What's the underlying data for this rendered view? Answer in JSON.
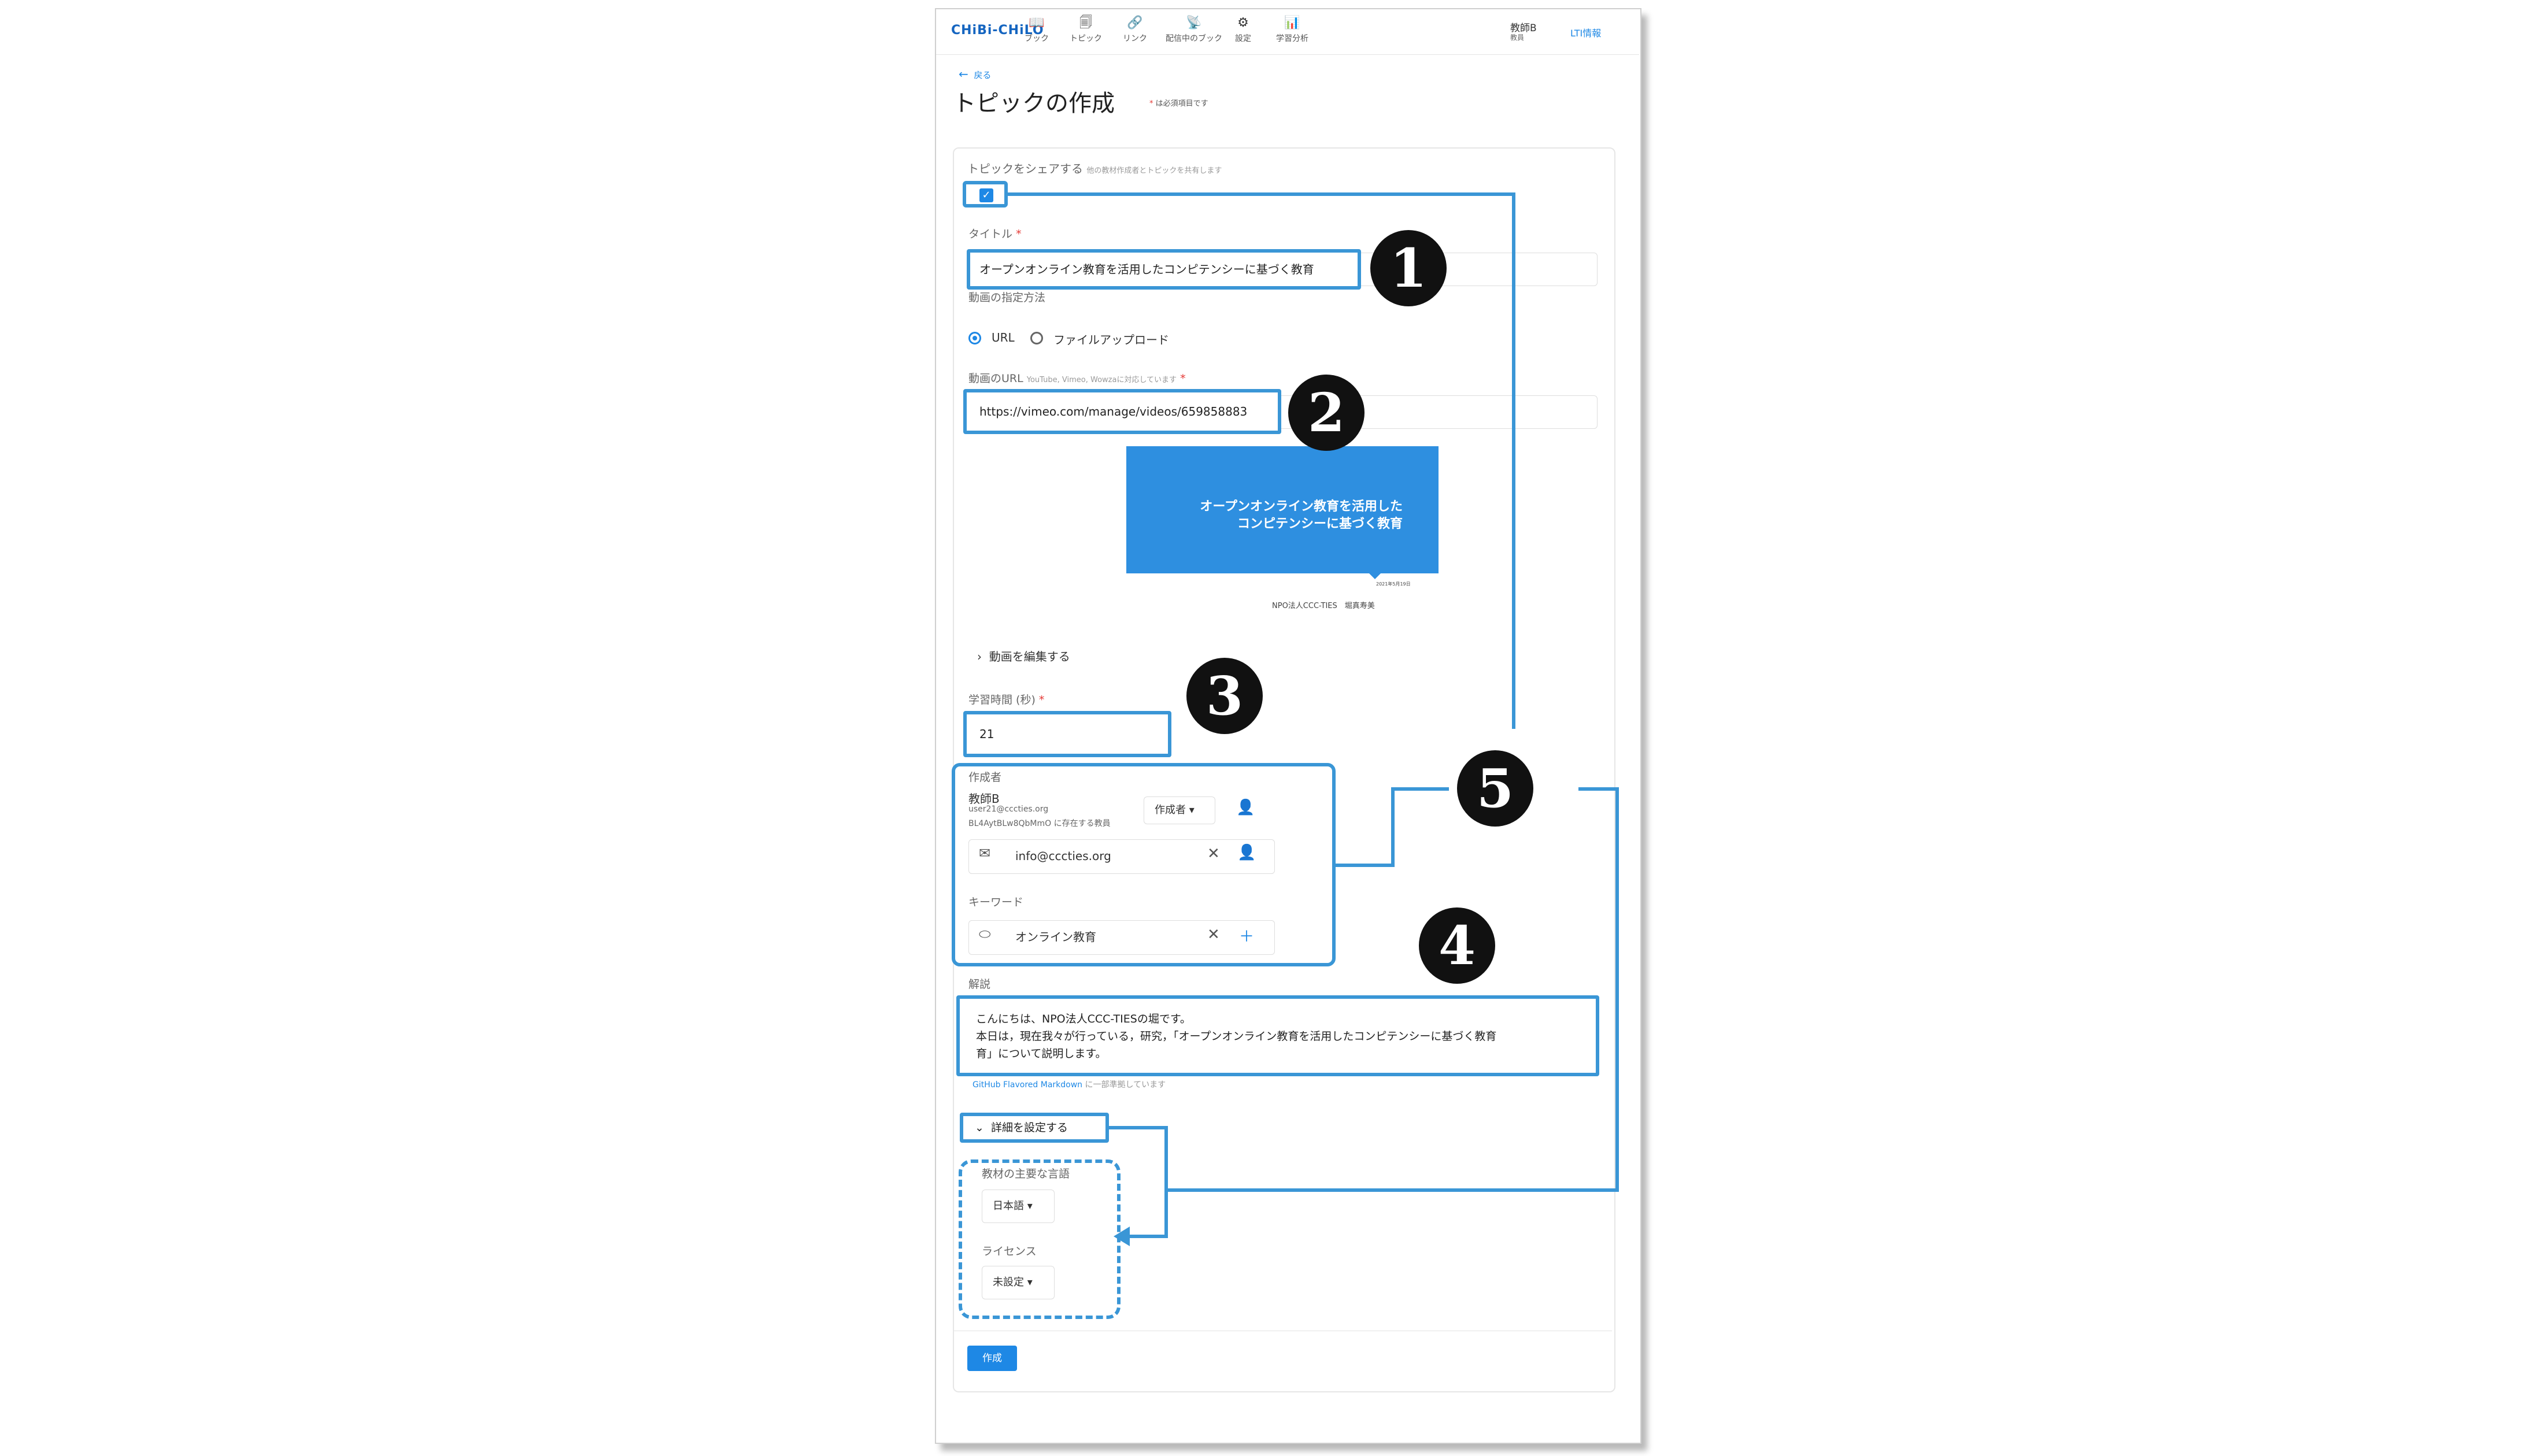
{
  "app": {
    "logo": "CHiBi-CHiLO"
  },
  "nav": [
    {
      "icon": "book-icon",
      "glyph": "📖",
      "label": "ブック"
    },
    {
      "icon": "topic-icon",
      "glyph": "🗐",
      "label": "トピック"
    },
    {
      "icon": "link-icon",
      "glyph": "🔗",
      "label": "リンク"
    },
    {
      "icon": "broadcast-icon",
      "glyph": "📡",
      "label": "配信中のブック"
    },
    {
      "icon": "gear-icon",
      "glyph": "⚙",
      "label": "設定"
    },
    {
      "icon": "analytics-icon",
      "glyph": "📊",
      "label": "学習分析"
    }
  ],
  "user": {
    "name": "教師B",
    "role": "教員",
    "lti": "LTI情報"
  },
  "page": {
    "back": "戻る",
    "title": "トピックの作成",
    "required_mark": "*",
    "required_note": "は必須項目です"
  },
  "share": {
    "label": "トピックをシェアする",
    "hint": "他の教材作成者とトピックを共有します"
  },
  "title_field": {
    "label": "タイトル",
    "value": "オープンオンライン教育を活用したコンピテンシーに基づく教育"
  },
  "video_method": {
    "label": "動画の指定方法",
    "option_url": "URL",
    "option_upload": "ファイルアップロード"
  },
  "video_url": {
    "label": "動画のURL",
    "hint": "YouTube, Vimeo, Wowzaに対応しています",
    "value": "https://vimeo.com/manage/videos/659858883"
  },
  "thumbnail": {
    "line1": "オープンオンライン教育を活用した",
    "line2": "コンピテンシーに基づく教育",
    "date": "2021年5月19日",
    "org": "NPO法人CCC-TIES　堀真寿美"
  },
  "edit_video": "動画を編集する",
  "duration": {
    "label": "学習時間 (秒)",
    "value": "21"
  },
  "authors": {
    "label": "作成者",
    "name": "教師B",
    "email": "user21@cccties.org",
    "id_note": "BL4AytBLw8QbMmO に存在する教員",
    "role_select": "作成者",
    "add_value": "info@cccties.org"
  },
  "keywords": {
    "label": "キーワード",
    "value": "オンライン教育"
  },
  "description": {
    "label": "解説",
    "lines": [
      "こんにちは、NPO法人CCC-TIESの堀です。",
      "本日は，現在我々が行っている，研究，「オープンオンライン教育を活用したコンピテンシーに基づく教育",
      "育」について説明します。"
    ],
    "markdown_link": "GitHub Flavored Markdown",
    "markdown_note": "に一部準拠しています"
  },
  "details": {
    "toggle": "詳細を設定する",
    "lang_label": "教材の主要な言語",
    "lang_value": "日本語",
    "license_label": "ライセンス",
    "license_value": "未設定"
  },
  "submit": "作成",
  "callouts": [
    "1",
    "2",
    "3",
    "4",
    "5"
  ],
  "colors": {
    "accent": "#1e88e5",
    "highlight": "#3a96d6"
  }
}
